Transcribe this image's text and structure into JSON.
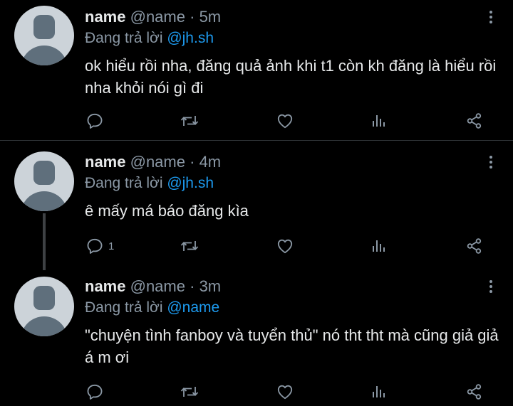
{
  "tweets": [
    {
      "name": "name",
      "handle": "@name",
      "dot": "·",
      "time": "5m",
      "reply_prefix": "Đang trả lời",
      "reply_to": "@jh.sh",
      "text": "ok hiểu rồi nha, đăng quả ảnh khi t1 còn kh đăng là hiểu rồi nha khỏi nói gì đi",
      "reply_count": ""
    },
    {
      "name": "name",
      "handle": "@name",
      "dot": "·",
      "time": "4m",
      "reply_prefix": "Đang trả lời",
      "reply_to": "@jh.sh",
      "text": "ê mấy má báo đăng kìa",
      "reply_count": "1"
    },
    {
      "name": "name",
      "handle": "@name",
      "dot": "·",
      "time": "3m",
      "reply_prefix": "Đang trả lời",
      "reply_to": "@name",
      "text": "\"chuyện tình fanboy và tuyển thủ\" nó tht tht mà cũng giả giả á m ơi",
      "reply_count": ""
    }
  ],
  "icons": {
    "reply": "reply-bubble-icon",
    "retweet": "retweet-icon",
    "like": "heart-icon",
    "analytics": "analytics-bars-icon",
    "share": "share-icon",
    "more": "more-vertical-icon"
  },
  "colors": {
    "background": "#000000",
    "text": "#e7e9ea",
    "secondary": "#8b98a5",
    "mention": "#1d9bf0",
    "divider": "#2f3336"
  }
}
